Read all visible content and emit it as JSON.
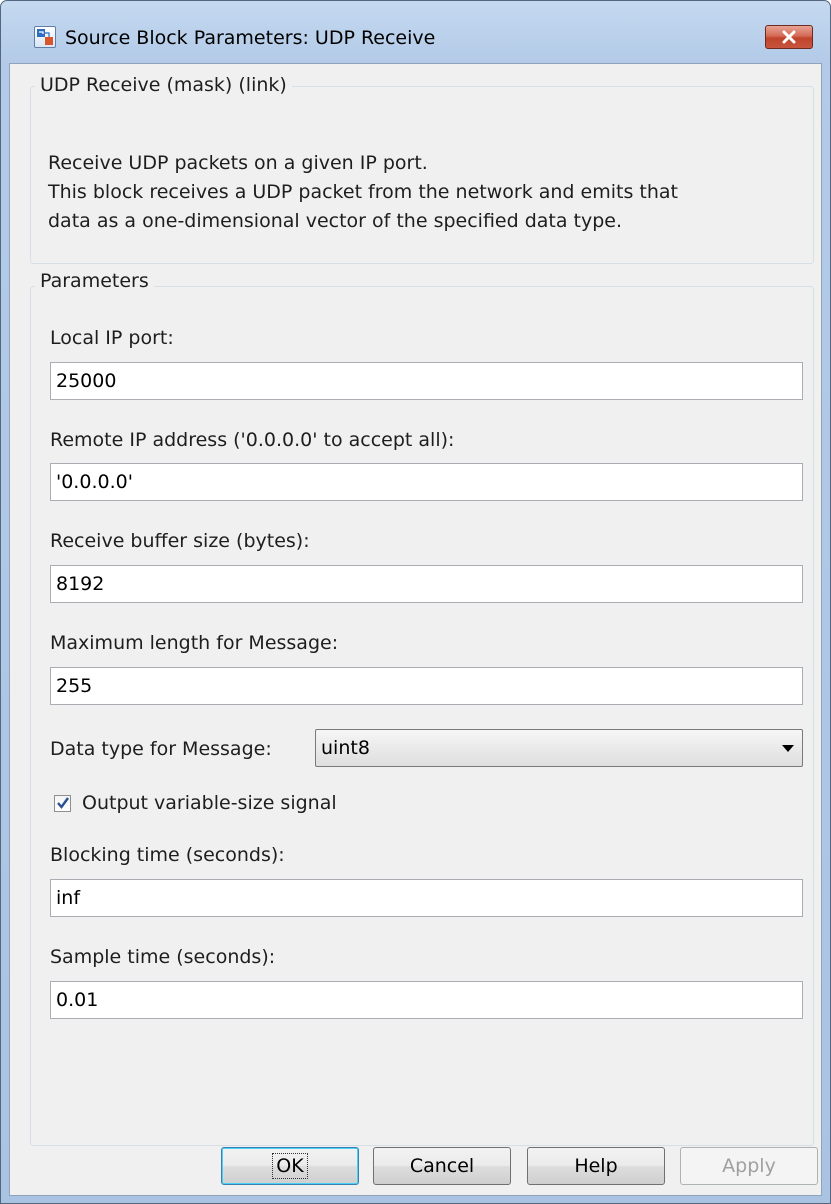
{
  "window": {
    "title": "Source Block Parameters: UDP Receive",
    "icon": "simulink-block-icon",
    "close_icon": "close-icon"
  },
  "description_group": {
    "legend": "UDP Receive (mask) (link)",
    "lines": [
      "Receive UDP packets on a given IP port.",
      "This block receives a UDP packet from the network and emits that",
      "data as a one-dimensional vector of the specified data type."
    ]
  },
  "parameters_group": {
    "legend": "Parameters",
    "local_port": {
      "label": "Local IP port:",
      "value": "25000"
    },
    "remote_ip": {
      "label": "Remote IP address ('0.0.0.0' to accept all):",
      "value": "'0.0.0.0'"
    },
    "buffer_size": {
      "label": "Receive buffer size (bytes):",
      "value": "8192"
    },
    "max_length": {
      "label": "Maximum length for Message:",
      "value": "255"
    },
    "data_type": {
      "label": "Data type for Message:",
      "value": "uint8",
      "icon": "chevron-down-icon"
    },
    "variable_size": {
      "label": "Output variable-size signal",
      "checked": true
    },
    "blocking_time": {
      "label": "Blocking time (seconds):",
      "value": "inf"
    },
    "sample_time": {
      "label": "Sample time (seconds):",
      "value": "0.01"
    }
  },
  "buttons": {
    "ok": "OK",
    "cancel": "Cancel",
    "help": "Help",
    "apply": "Apply"
  }
}
